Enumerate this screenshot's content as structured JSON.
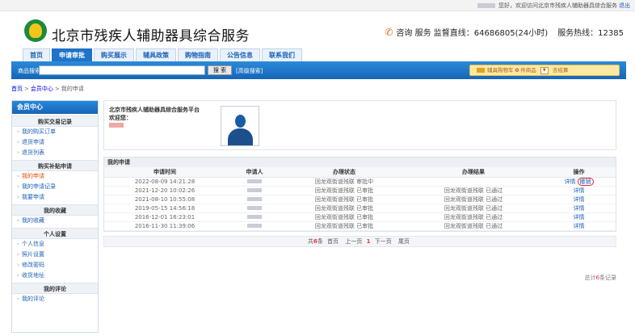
{
  "topbar": {
    "welcome": "您好，欢迎访问北京市残疾人辅助器具综合服务",
    "logout": "退出"
  },
  "header": {
    "site_title": "北京市残疾人辅助器具综合服务",
    "consult": "咨询 服务 监督直线：64686805(24小时)",
    "hotline": "服务热线：12385"
  },
  "nav": [
    "首页",
    "申请审批",
    "购买展示",
    "辅具政策",
    "购物指南",
    "公告信息",
    "联系我们"
  ],
  "search": {
    "label": "商品搜索:",
    "value": "",
    "button": "搜 索",
    "advanced": "[高级搜索]"
  },
  "cart": {
    "label": "辅具购物车",
    "count": "0",
    "unit": "件商品",
    "checkout": "去结算"
  },
  "breadcrumb": {
    "home": "首页",
    "member": "会员中心",
    "current": "我的申请"
  },
  "sidebar": {
    "title": "会员中心",
    "groups": [
      {
        "title": "购买交易记录",
        "items": [
          "我的购买订单",
          "退货申请",
          "退货列表"
        ]
      },
      {
        "title": "购买补贴申请",
        "items": [
          "我的申请",
          "我的申请记录",
          "我要申请"
        ]
      },
      {
        "title": "我的收藏",
        "items": [
          "我的收藏"
        ]
      },
      {
        "title": "个人设置",
        "items": [
          "个人信息",
          "照片设置",
          "修改密码",
          "收货地址"
        ]
      },
      {
        "title": "我的评论",
        "items": [
          "我的评论"
        ]
      }
    ]
  },
  "profile": {
    "org": "北京市残疾人辅助器具综合服务平台",
    "welcome": "欢迎您："
  },
  "applications": {
    "title": "我的申请",
    "columns": [
      "申请时间",
      "申请人",
      "办理状态",
      "办理结果",
      "操作"
    ],
    "rows": [
      {
        "time": "2022-08-09 14:21:28",
        "status": "回龙观街道残联 审批中",
        "result": "",
        "ops": [
          "详情",
          "撤销"
        ]
      },
      {
        "time": "2021-12-20 10:02:26",
        "status": "回龙观街道残联 已审批",
        "result": "回龙观街道残联 已通过",
        "ops": [
          "详情"
        ]
      },
      {
        "time": "2021-08-10 10:55:08",
        "status": "回龙观街道残联 已审批",
        "result": "回龙观街道残联 已通过",
        "ops": [
          "详情"
        ]
      },
      {
        "time": "2019-05-15 14:56:18",
        "status": "回龙观街道残联 已审批",
        "result": "回龙观街道残联 已通过",
        "ops": [
          "详情"
        ]
      },
      {
        "time": "2016-12-01 16:23:01",
        "status": "回龙观街道残联 已审批",
        "result": "回龙观街道残联 已通过",
        "ops": [
          "详情"
        ]
      },
      {
        "time": "2016-11-30 11:39:06",
        "status": "回龙观街道残联 已审批",
        "result": "回龙观街道残联 已通过",
        "ops": [
          "详情"
        ]
      }
    ]
  },
  "pager": {
    "prefix": "共",
    "count": "6",
    "suffix": "条",
    "first": "首页",
    "prev": "上一页",
    "page": "1",
    "next": "下一页",
    "last": "尾页"
  },
  "total": {
    "prefix": "总计",
    "count": "6",
    "suffix": "条记录"
  }
}
